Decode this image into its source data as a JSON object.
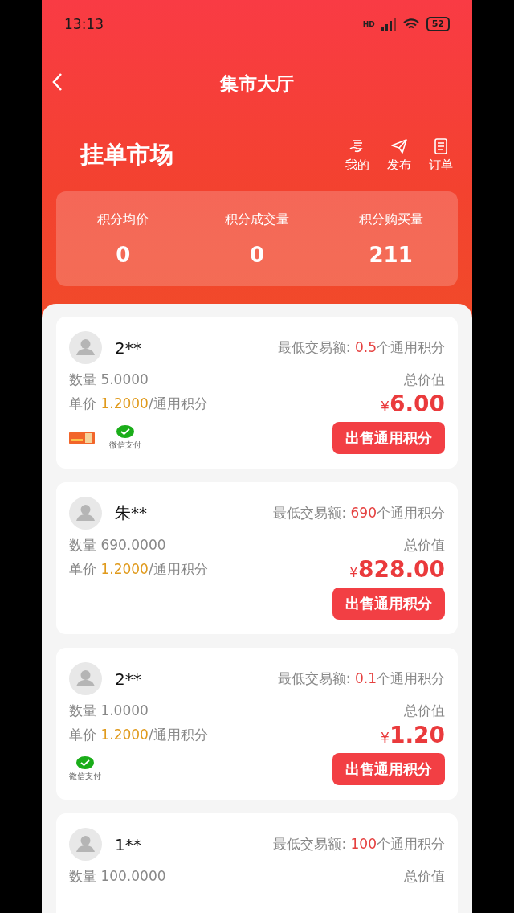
{
  "status_bar": {
    "time": "13:13",
    "signal_label": "HD",
    "battery": "52"
  },
  "nav": {
    "title": "集市大厅"
  },
  "header": {
    "title": "挂单市场",
    "actions": [
      {
        "kind": "mine",
        "label": "我的"
      },
      {
        "kind": "publish",
        "label": "发布"
      },
      {
        "kind": "orders",
        "label": "订单"
      }
    ]
  },
  "stats": [
    {
      "label": "积分均价",
      "value": "0"
    },
    {
      "label": "积分成交量",
      "value": "0"
    },
    {
      "label": "积分购买量",
      "value": "211"
    }
  ],
  "listings": [
    {
      "name": "2**",
      "min_label": "最低交易额: ",
      "min_value": "0.5",
      "min_unit": "个通用积分",
      "quantity": "数量 5.0000",
      "price_label": "单价 ",
      "price": "1.2000",
      "price_unit": "/通用积分",
      "total_label": "总价值",
      "currency": "¥",
      "total": "6.00",
      "button": "出售通用积分",
      "payments": [
        {
          "kind": "card"
        },
        {
          "kind": "wechat",
          "label": "微信支付"
        }
      ]
    },
    {
      "name": "朱**",
      "min_label": "最低交易额: ",
      "min_value": "690",
      "min_unit": "个通用积分",
      "quantity": "数量 690.0000",
      "price_label": "单价 ",
      "price": "1.2000",
      "price_unit": "/通用积分",
      "total_label": "总价值",
      "currency": "¥",
      "total": "828.00",
      "button": "出售通用积分"
    },
    {
      "name": "2**",
      "min_label": "最低交易额: ",
      "min_value": "0.1",
      "min_unit": "个通用积分",
      "quantity": "数量 1.0000",
      "price_label": "单价 ",
      "price": "1.2000",
      "price_unit": "/通用积分",
      "total_label": "总价值",
      "currency": "¥",
      "total": "1.20",
      "button": "出售通用积分",
      "payments": [
        {
          "kind": "wechat",
          "label": "微信支付"
        }
      ]
    },
    {
      "name": "1**",
      "min_label": "最低交易额: ",
      "min_value": "100",
      "min_unit": "个通用积分",
      "quantity": "数量 100.0000",
      "total_label": "总价值"
    }
  ]
}
